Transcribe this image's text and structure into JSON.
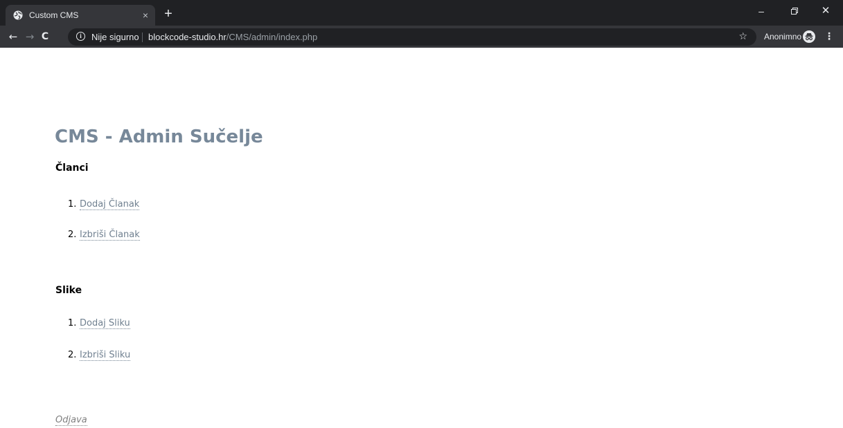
{
  "browser": {
    "tab_title": "Custom CMS",
    "tab_close": "×",
    "new_tab": "+",
    "window_controls": {
      "minimize": "–",
      "restore": "⧉",
      "close": "✕"
    },
    "nav": {
      "back": "←",
      "forward": "→",
      "reload": "C"
    },
    "omnibox": {
      "security_label": "Nije sigurno",
      "url_host": "blockcode-studio.hr",
      "url_path": "/CMS/admin/index.php"
    },
    "bookmark_icon": "☆",
    "profile_label": "Anonimno",
    "menu_icon": "⋮",
    "icons": [
      "globe-icon",
      "info-icon",
      "star-icon",
      "incognito-icon",
      "menu-icon"
    ]
  },
  "page": {
    "title": "CMS - Admin Sučelje",
    "sections": [
      {
        "heading": "Članci",
        "items": [
          {
            "number": "1.",
            "label": "Dodaj Članak"
          },
          {
            "number": "2.",
            "label": "Izbriši Članak"
          }
        ]
      },
      {
        "heading": "Slike",
        "items": [
          {
            "number": "1.",
            "label": "Dodaj Sliku"
          },
          {
            "number": "2.",
            "label": "Izbriši Sliku"
          }
        ]
      }
    ],
    "logout_label": "Odjava"
  },
  "colors": {
    "title": "#778899",
    "link": "#708090",
    "chrome_dark": "#202124",
    "chrome_toolbar": "#35363a"
  }
}
